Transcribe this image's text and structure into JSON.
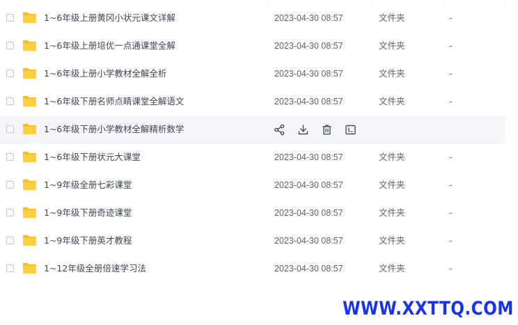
{
  "file_list": {
    "rows": [
      {
        "name": "1~6年级上册黄冈小状元课文详解",
        "modified": "2023-04-30 08:57",
        "type": "文件夹",
        "size": "-"
      },
      {
        "name": "1~6年级上册培优一点通课堂全解",
        "modified": "2023-04-30 08:57",
        "type": "文件夹",
        "size": "-"
      },
      {
        "name": "1~6年级上册小学教材全解全析",
        "modified": "2023-04-30 08:57",
        "type": "文件夹",
        "size": "-"
      },
      {
        "name": "1~6年级下册名师点睛课堂全解语文",
        "modified": "2023-04-30 08:57",
        "type": "文件夹",
        "size": "-"
      },
      {
        "name": "1~6年级下册小学教材全解精析数学",
        "hovered": true,
        "actions": [
          "share-icon",
          "download-icon",
          "delete-icon",
          "rename-icon"
        ]
      },
      {
        "name": "1~6年级下册状元大课堂",
        "modified": "2023-04-30 08:57",
        "type": "文件夹",
        "size": "-"
      },
      {
        "name": "1~9年级全册七彩课堂",
        "modified": "2023-04-30 08:57",
        "type": "文件夹",
        "size": "-"
      },
      {
        "name": "1~9年级下册奇迹课堂",
        "modified": "2023-04-30 08:57",
        "type": "文件夹",
        "size": "-"
      },
      {
        "name": "1~9年级下册英才教程",
        "modified": "2023-04-30 08:57",
        "type": "文件夹",
        "size": "-"
      },
      {
        "name": "1~12年级全册倍速学习法",
        "modified": "2023-04-30 08:57",
        "type": "文件夹",
        "size": "-"
      }
    ]
  },
  "watermark": {
    "text": "WWW.XXTTQ.COM",
    "color": "#1733f0"
  },
  "colors": {
    "folder": "#ffcf3f",
    "folder_tab": "#f5bb23",
    "hover_row": "#f5f6f9",
    "icon": "#454d5a"
  }
}
